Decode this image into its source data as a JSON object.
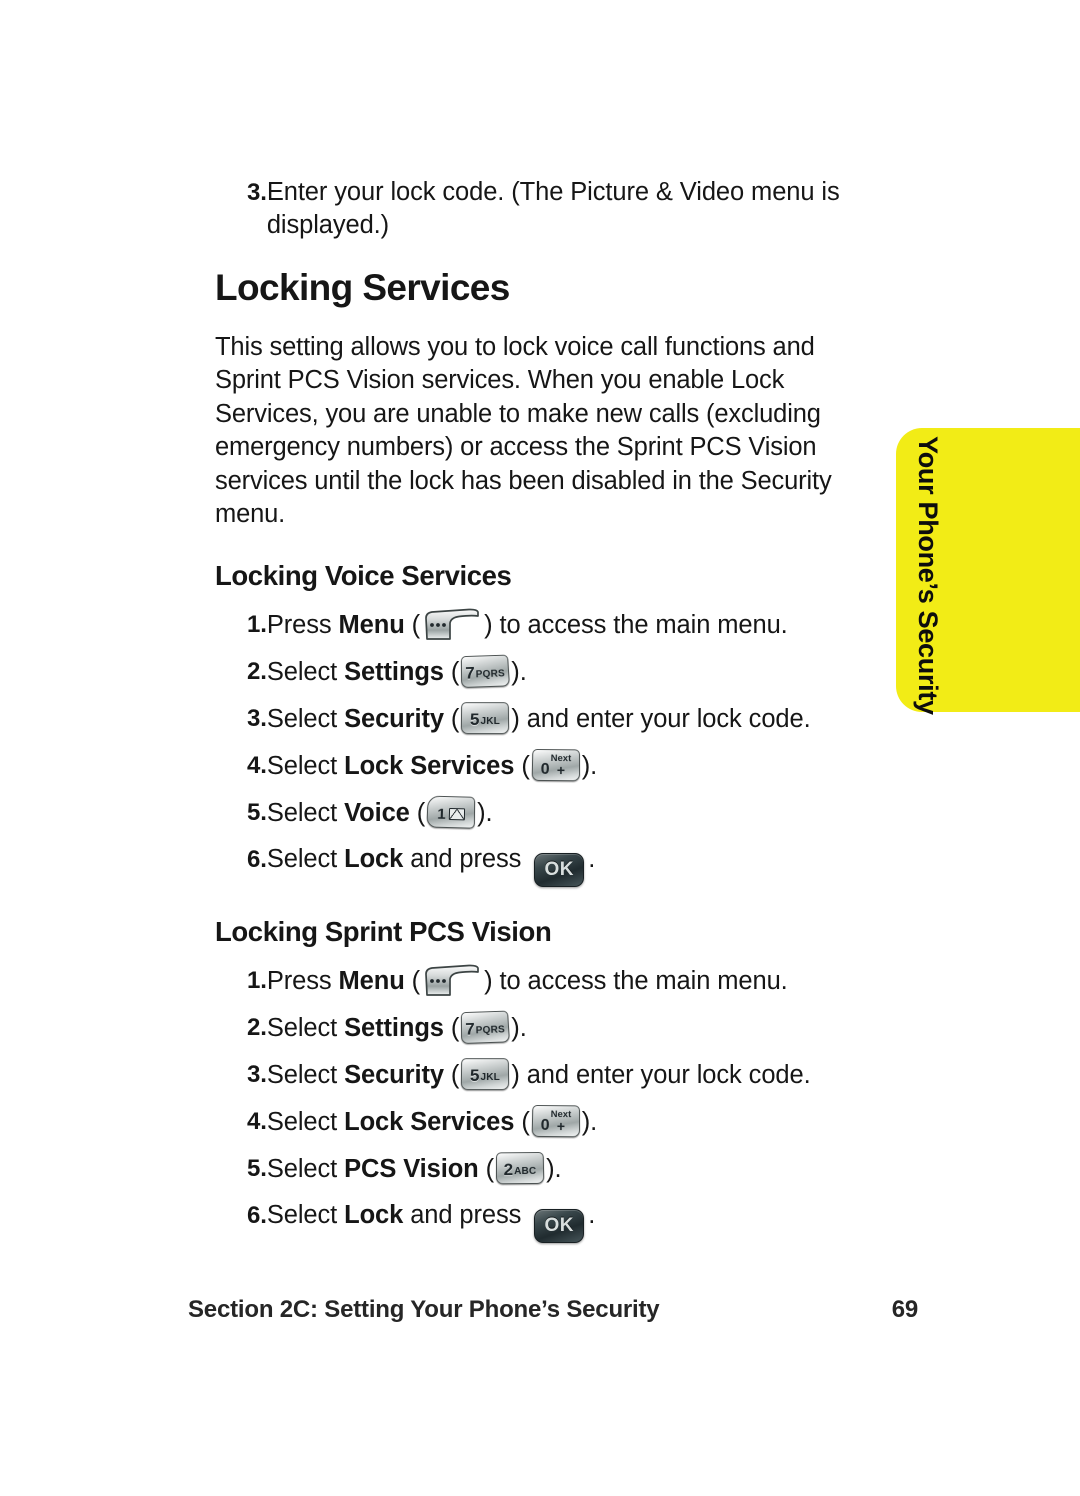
{
  "page": {
    "background_color": "#ffffff",
    "text_color": "#161616"
  },
  "intro_step": {
    "number": "3.",
    "text": "Enter your lock code. (The Picture & Video menu is displayed.)"
  },
  "section": {
    "heading": "Locking Services",
    "paragraph": "This setting allows you to lock voice call functions and Sprint PCS Vision services. When you enable Lock Services, you are unable to make new calls (excluding emergency numbers) or access the Sprint PCS Vision services until the lock has been disabled in the Security menu."
  },
  "voice_procedure": {
    "heading": "Locking Voice Services",
    "steps": [
      {
        "number": "1.",
        "pre": "Press ",
        "bold": "Menu",
        "open_paren": " (",
        "key": "menu-soft-key",
        "close_paren": ") ",
        "post": "to access the main menu."
      },
      {
        "number": "2.",
        "pre": "Select ",
        "bold": "Settings",
        "open_paren": " (",
        "key": "key-7-pqrs",
        "close_paren": ")",
        "post": "."
      },
      {
        "number": "3.",
        "pre": "Select ",
        "bold": "Security",
        "open_paren": " (",
        "key": "key-5-jkl",
        "close_paren": ") ",
        "post": "and enter your lock code."
      },
      {
        "number": "4.",
        "pre": "Select ",
        "bold": "Lock Services",
        "open_paren": " (",
        "key": "key-0-next-plus",
        "close_paren": ")",
        "post": "."
      },
      {
        "number": "5.",
        "pre": "Select ",
        "bold": "Voice",
        "open_paren": " (",
        "key": "key-1-voicemail",
        "close_paren": ")",
        "post": "."
      },
      {
        "number": "6.",
        "pre": "Select ",
        "bold": "Lock",
        "open_paren": " and press ",
        "key": "key-ok",
        "close_paren": "",
        "post": "."
      }
    ]
  },
  "vision_procedure": {
    "heading": "Locking Sprint PCS Vision",
    "steps": [
      {
        "number": "1.",
        "pre": "Press ",
        "bold": "Menu",
        "open_paren": " (",
        "key": "menu-soft-key",
        "close_paren": ") ",
        "post": "to access the main menu."
      },
      {
        "number": "2.",
        "pre": "Select ",
        "bold": "Settings",
        "open_paren": " (",
        "key": "key-7-pqrs",
        "close_paren": ")",
        "post": "."
      },
      {
        "number": "3.",
        "pre": "Select ",
        "bold": "Security",
        "open_paren": " (",
        "key": "key-5-jkl",
        "close_paren": ") ",
        "post": "and enter your lock code."
      },
      {
        "number": "4.",
        "pre": "Select ",
        "bold": "Lock Services",
        "open_paren": " (",
        "key": "key-0-next-plus",
        "close_paren": ")",
        "post": "."
      },
      {
        "number": "5.",
        "pre": "Select ",
        "bold": "PCS Vision",
        "open_paren": " (",
        "key": "key-2-abc",
        "close_paren": ")",
        "post": "."
      },
      {
        "number": "6.",
        "pre": "Select ",
        "bold": "Lock",
        "open_paren": " and press ",
        "key": "key-ok",
        "close_paren": "",
        "post": "."
      }
    ]
  },
  "keys": {
    "k7": {
      "digit": "7",
      "letters": "PQRS"
    },
    "k5": {
      "digit": "5",
      "letters": "JKL"
    },
    "k0": {
      "digit": "0",
      "next": "Next",
      "plus": "+"
    },
    "k1": {
      "digit": "1",
      "icon": "envelope-icon"
    },
    "k2": {
      "digit": "2",
      "letters": "ABC"
    },
    "ok": {
      "label": "OK"
    }
  },
  "side_tab": {
    "label": "Your Phone’s Security",
    "color": "#F2EC16"
  },
  "footer": {
    "section_label": "Section 2C: Setting Your Phone’s Security",
    "page_number": "69"
  }
}
